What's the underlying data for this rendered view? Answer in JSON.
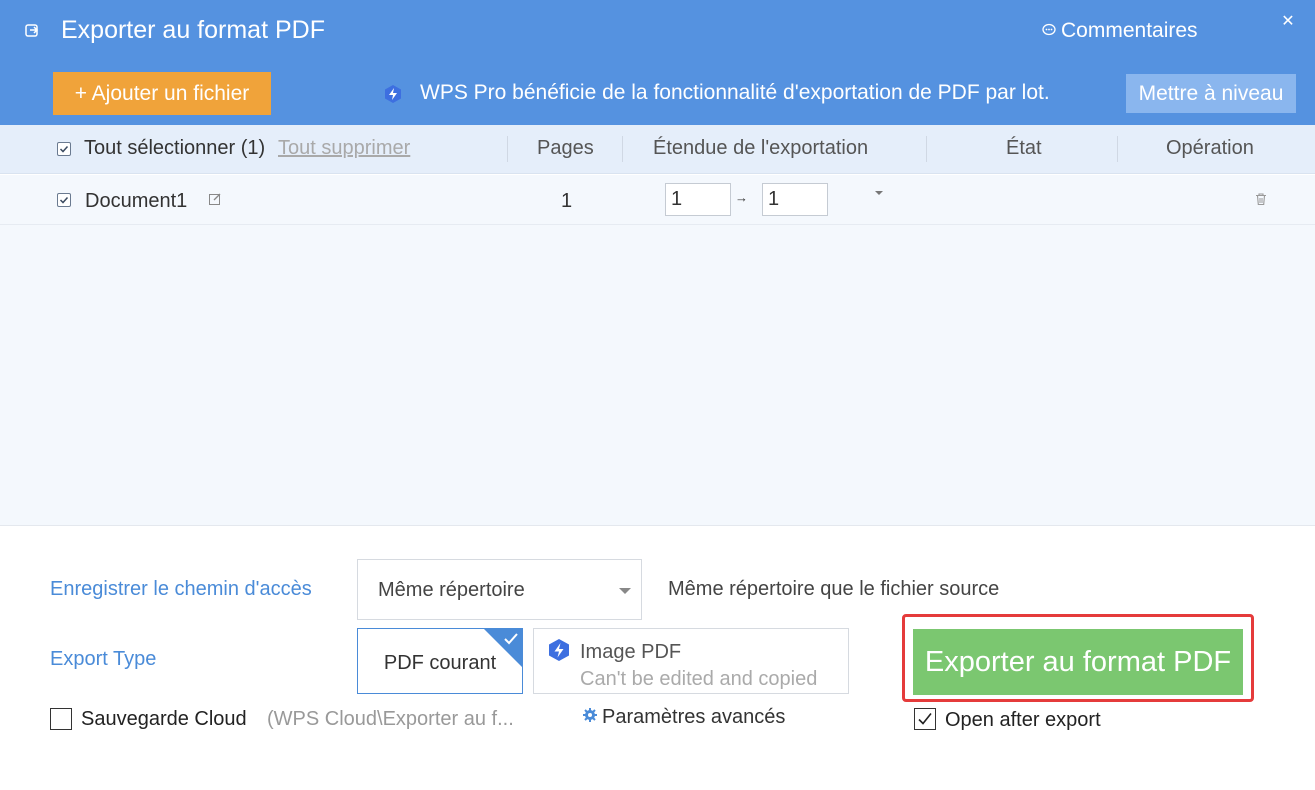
{
  "window": {
    "title": "Exporter au format PDF",
    "comments_label": "Commentaires",
    "close_symbol": "✕"
  },
  "toolbar": {
    "add_file_label": "+ Ajouter un fichier",
    "promo_text": "WPS Pro bénéficie de la fonctionnalité d'exportation de PDF par lot.",
    "upgrade_label": "Mettre à niveau"
  },
  "table": {
    "select_all_label": "Tout sélectionner (1)",
    "clear_all_label": "Tout supprimer",
    "columns": [
      "Pages",
      "Étendue de l'exportation",
      "État",
      "Opération"
    ],
    "rows": [
      {
        "name": "Document1",
        "checked": true,
        "pages": "1",
        "range_from": "1",
        "range_arrow": "→",
        "range_to": "1",
        "state": ""
      }
    ]
  },
  "options": {
    "save_path_label": "Enregistrer le chemin d'accès",
    "save_path_value": "Même répertoire",
    "save_path_hint": "Même répertoire que le fichier source",
    "export_type_label": "Export Type",
    "type_current": "PDF courant",
    "type_image_title": "Image PDF",
    "type_image_sub": "Can't be edited and copied",
    "cloud_backup_label": "Sauvegarde Cloud",
    "cloud_backup_checked": false,
    "cloud_path": "(WPS Cloud\\Exporter au f...",
    "advanced_label": "Paramètres avancés",
    "export_button": "Exporter au format PDF",
    "open_after_label": "Open after export",
    "open_after_checked": true
  },
  "colors": {
    "header": "#5592e0",
    "add_button": "#f0a33a",
    "export_button": "#7bc770",
    "highlight_frame": "#e53b3b",
    "accent": "#4a8bd8"
  },
  "icons": {
    "title": "export-icon",
    "comments": "speech-bubble-icon",
    "close": "close-icon",
    "promo": "lightning-bolt-icon",
    "edit": "edit-icon",
    "dropdown": "caret-down-icon",
    "delete": "trash-icon",
    "advanced": "gear-icon",
    "check": "checkmark-icon"
  }
}
